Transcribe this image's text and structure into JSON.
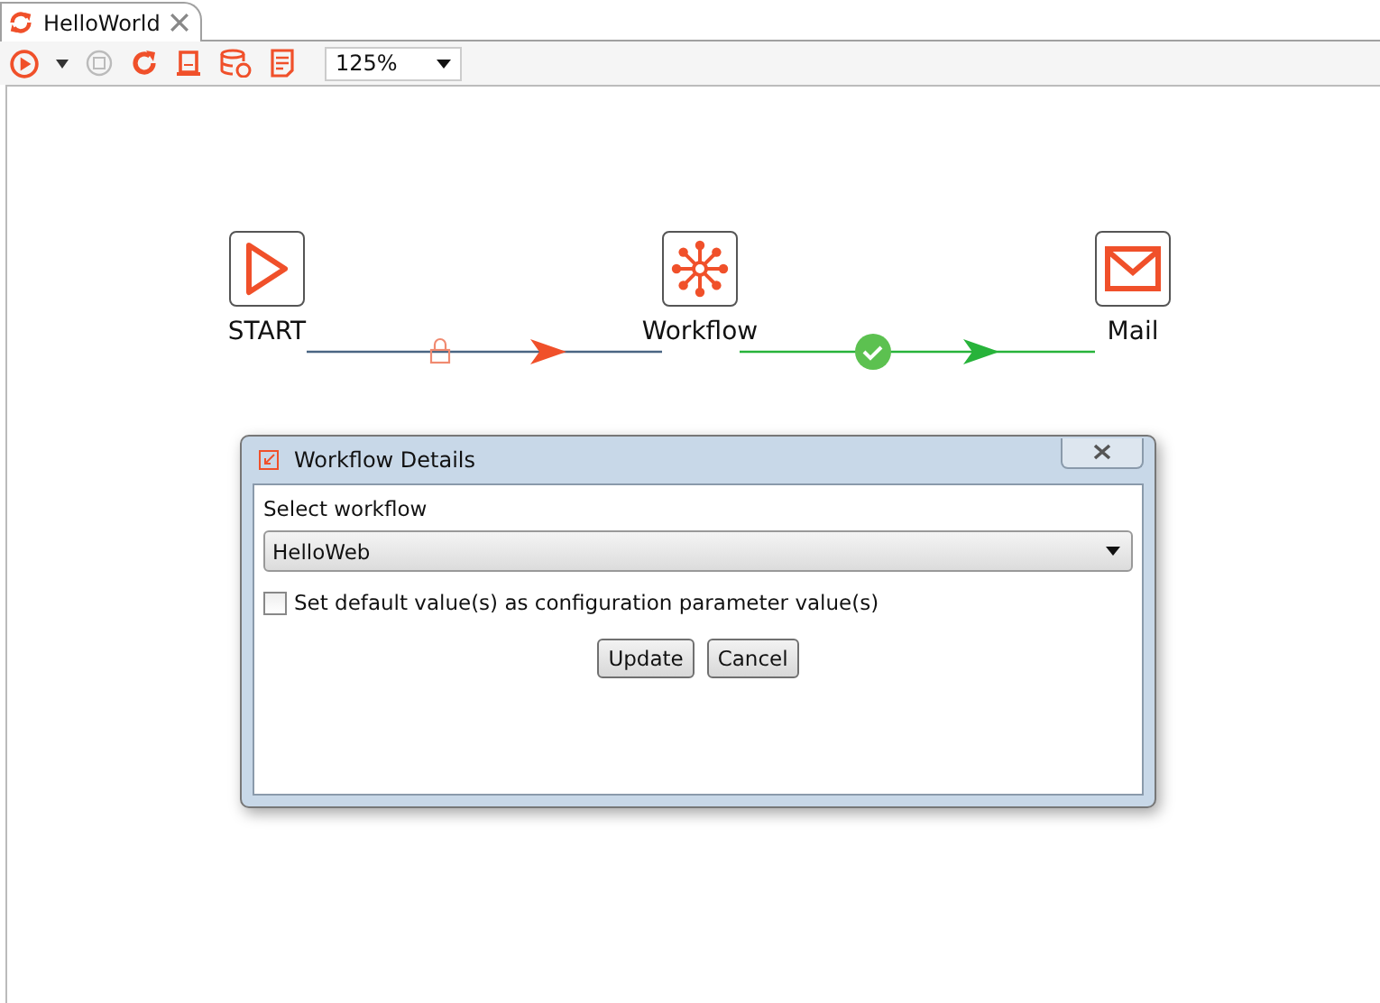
{
  "tab": {
    "title": "HelloWorld"
  },
  "toolbar": {
    "zoom": "125%"
  },
  "nodes": [
    {
      "label": "START",
      "kind": "start"
    },
    {
      "label": "Workflow",
      "kind": "workflow"
    },
    {
      "label": "Mail",
      "kind": "mail"
    }
  ],
  "connections": [
    {
      "kind": "locked"
    },
    {
      "kind": "success"
    }
  ],
  "dialog": {
    "title": "Workflow Details",
    "field_label": "Select workflow",
    "select_value": "HelloWeb",
    "checkbox": {
      "label": "Set default value(s) as configuration parameter value(s)",
      "checked": false
    },
    "buttons": [
      "Update",
      "Cancel"
    ]
  }
}
